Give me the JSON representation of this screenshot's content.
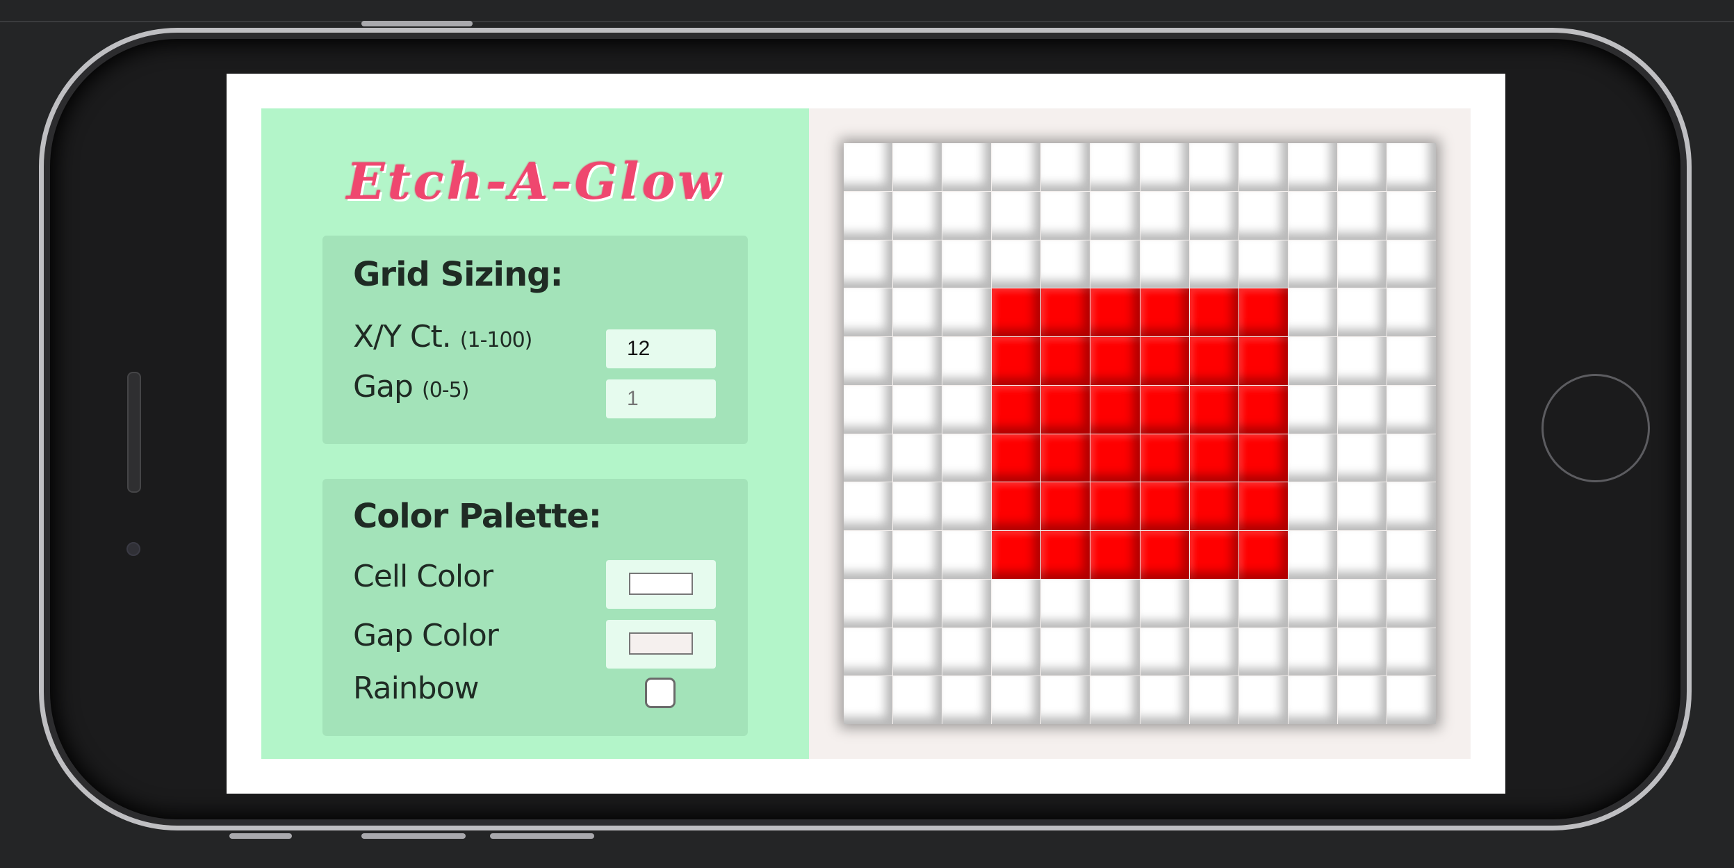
{
  "app": {
    "title": "Etch-A-Glow"
  },
  "grid_sizing": {
    "heading": "Grid Sizing:",
    "count_label": "X/Y Ct.",
    "count_hint": "(1-100)",
    "count_value": "12",
    "gap_label": "Gap",
    "gap_hint": "(0-5)",
    "gap_placeholder": "1"
  },
  "color_palette": {
    "heading": "Color Palette:",
    "cell_color_label": "Cell Color",
    "cell_color_value": "#ffffff",
    "gap_color_label": "Gap Color",
    "gap_color_value": "#f5f0ee",
    "rainbow_label": "Rainbow",
    "rainbow_checked": false
  },
  "canvas": {
    "columns": 12,
    "rows": 12,
    "cell_color": "#ffffff",
    "paint_color": "#ff0000",
    "filled_rows": [
      3,
      4,
      5,
      6,
      7,
      8
    ],
    "filled_cols": [
      3,
      4,
      5,
      6,
      7,
      8
    ]
  }
}
